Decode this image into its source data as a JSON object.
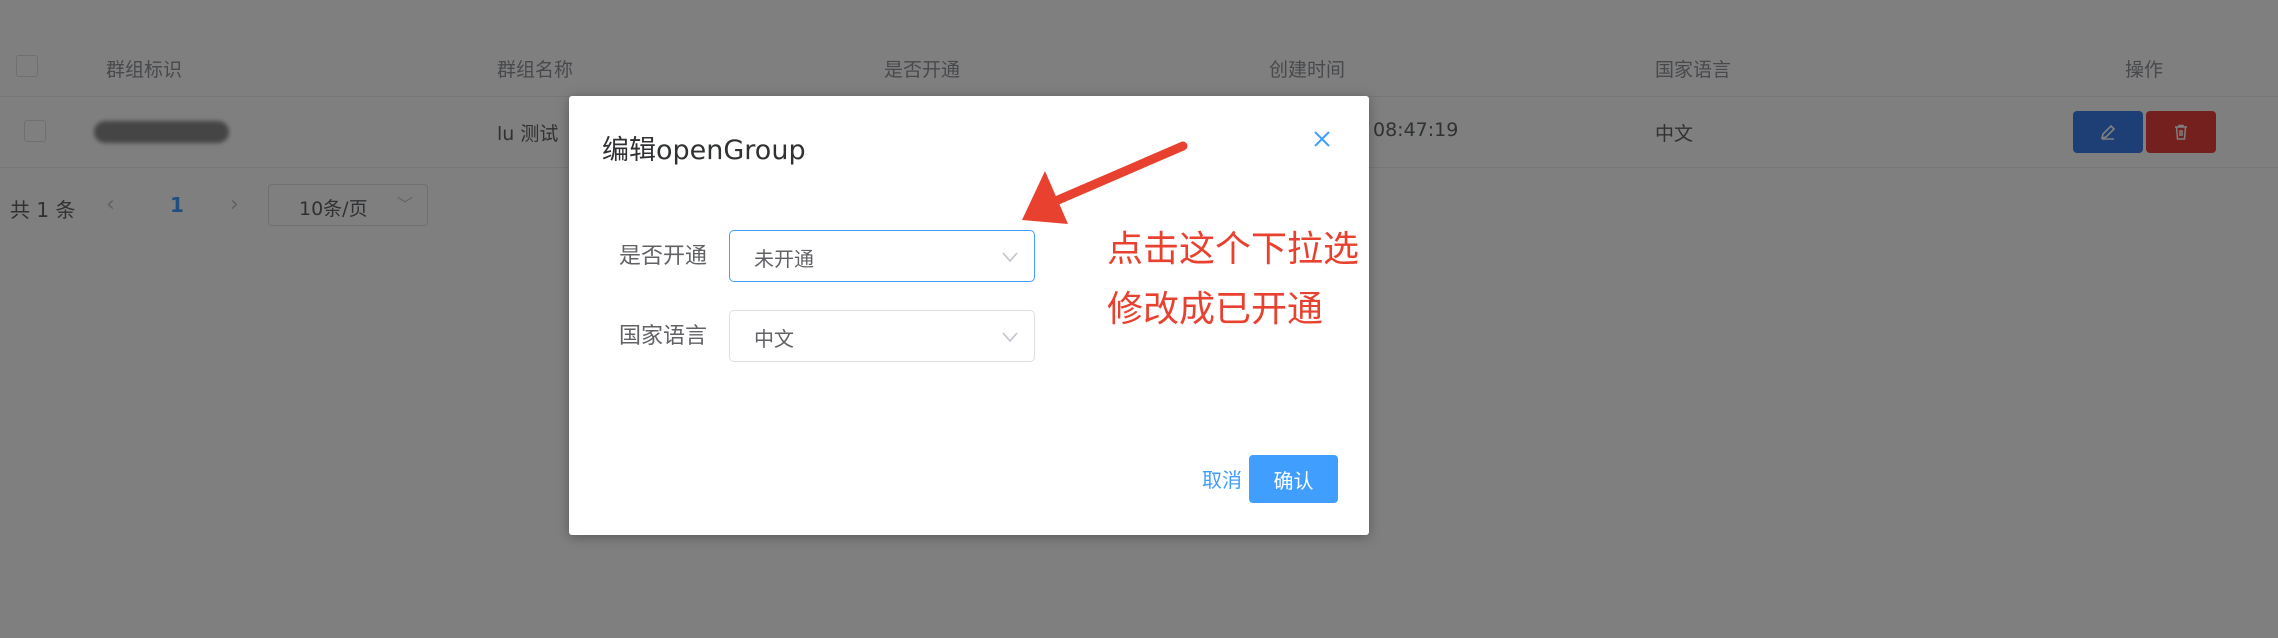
{
  "table": {
    "headers": [
      "群组标识",
      "群组名称",
      "是否开通",
      "创建时间",
      "国家语言",
      "操作"
    ],
    "row": {
      "group_name": "lu 测试",
      "created_time": "08:47:19",
      "language": "中文"
    }
  },
  "pagination": {
    "total": "共 1 条",
    "prev": "‹",
    "current": "1",
    "next": "›",
    "page_size": "10条/页"
  },
  "dialog": {
    "title": "编辑openGroup",
    "fields": [
      {
        "label": "是否开通",
        "value": "未开通"
      },
      {
        "label": "国家语言",
        "value": "中文"
      }
    ],
    "cancel_label": "取消",
    "confirm_label": "确认"
  },
  "annotation": {
    "line1": "点击这个下拉选",
    "line2": "修改成已开通",
    "color": "#e8412f"
  },
  "colors": {
    "primary": "#409eff",
    "edit": "#3d7fea",
    "delete": "#e8413c"
  }
}
